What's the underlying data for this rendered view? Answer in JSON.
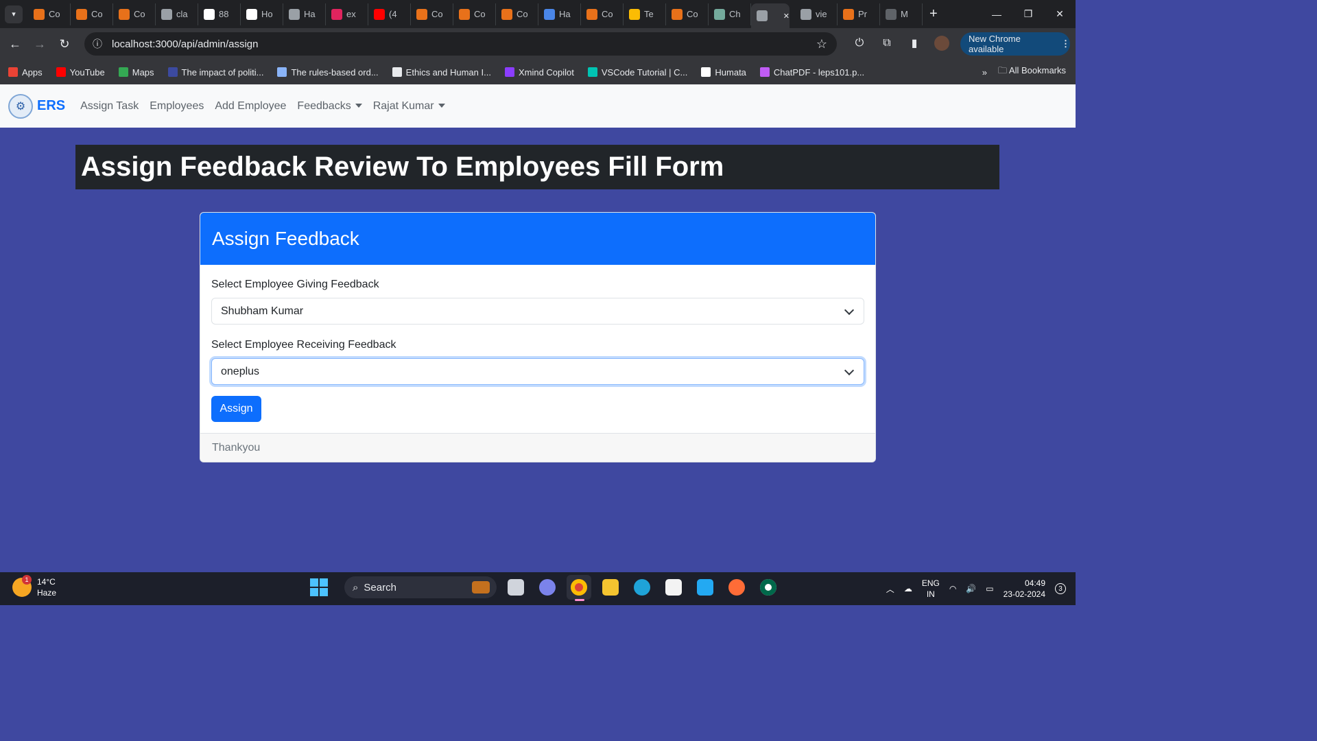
{
  "browser": {
    "tabs": [
      {
        "label": "Co",
        "color": "#e8711a"
      },
      {
        "label": "Co",
        "color": "#e8711a"
      },
      {
        "label": "Co",
        "color": "#e8711a"
      },
      {
        "label": "cla",
        "color": "#9aa0a6"
      },
      {
        "label": "88",
        "color": "#ffffff"
      },
      {
        "label": "Ho",
        "color": "#ffffff"
      },
      {
        "label": "Ha",
        "color": "#9aa0a6"
      },
      {
        "label": "ex",
        "color": "#e0245e"
      },
      {
        "label": "(4",
        "color": "#ff0000"
      },
      {
        "label": "Co",
        "color": "#e8711a"
      },
      {
        "label": "Co",
        "color": "#e8711a"
      },
      {
        "label": "Co",
        "color": "#e8711a"
      },
      {
        "label": "Ha",
        "color": "#4a86e8"
      },
      {
        "label": "Co",
        "color": "#e8711a"
      },
      {
        "label": "Te",
        "color": "#fbbc04"
      },
      {
        "label": "Co",
        "color": "#e8711a"
      },
      {
        "label": "Ch",
        "color": "#74aa9c"
      }
    ],
    "active_tab": {
      "label": ""
    },
    "after_tabs": [
      {
        "label": "vie",
        "color": "#9aa0a6"
      },
      {
        "label": "Pr",
        "color": "#e8711a"
      },
      {
        "label": "M",
        "color": "#5f6368"
      }
    ],
    "url": "localhost:3000/api/admin/assign",
    "update_label": "New Chrome available",
    "bookmarks": [
      {
        "label": "Apps",
        "color": "#ea4335"
      },
      {
        "label": "YouTube",
        "color": "#ff0000"
      },
      {
        "label": "Maps",
        "color": "#34a853"
      },
      {
        "label": "The impact of politi...",
        "color": "#3c4aa0"
      },
      {
        "label": "The rules-based ord...",
        "color": "#8ab4f8"
      },
      {
        "label": "Ethics and Human I...",
        "color": "#e8eaed"
      },
      {
        "label": "Xmind Copilot",
        "color": "#8b3dff"
      },
      {
        "label": "VSCode Tutorial | C...",
        "color": "#00c4b3"
      },
      {
        "label": "Humata",
        "color": "#ffffff"
      },
      {
        "label": "ChatPDF - leps101.p...",
        "color": "#c05cf5"
      }
    ],
    "all_bookmarks": "All Bookmarks"
  },
  "app": {
    "brand": "ERS",
    "nav": {
      "assign_task": "Assign Task",
      "employees": "Employees",
      "add_employee": "Add Employee",
      "feedbacks": "Feedbacks",
      "user": "Rajat Kumar"
    },
    "page_title": "Assign Feedback Review To Employees Fill Form",
    "card": {
      "title": "Assign Feedback",
      "giver_label": "Select Employee Giving Feedback",
      "giver_value": "Shubham Kumar",
      "receiver_label": "Select Employee Receiving Feedback",
      "receiver_value": "oneplus",
      "submit": "Assign",
      "footer": "Thankyou"
    }
  },
  "taskbar": {
    "weather_badge": "1",
    "temperature": "14°C",
    "condition": "Haze",
    "search_label": "Search",
    "lang_top": "ENG",
    "lang_bottom": "IN",
    "time": "04:49",
    "date": "23-02-2024",
    "notifications": "3"
  }
}
